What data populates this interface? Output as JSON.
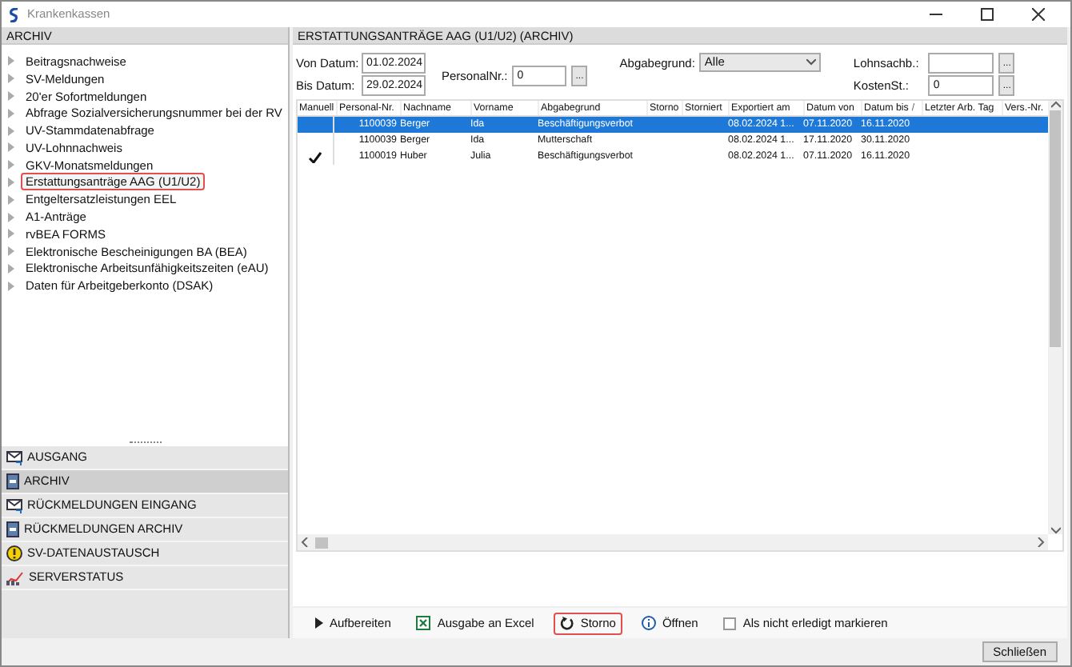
{
  "window": {
    "title": "Krankenkassen"
  },
  "sidebar": {
    "header": "ARCHIV",
    "tree": [
      {
        "label": "Beitragsnachweise",
        "selected": false
      },
      {
        "label": "SV-Meldungen",
        "selected": false
      },
      {
        "label": "20'er Sofortmeldungen",
        "selected": false
      },
      {
        "label": "Abfrage Sozialversicherungsnummer bei der RV",
        "selected": false
      },
      {
        "label": "UV-Stammdatenabfrage",
        "selected": false
      },
      {
        "label": "UV-Lohnnachweis",
        "selected": false
      },
      {
        "label": "GKV-Monatsmeldungen",
        "selected": false
      },
      {
        "label": "Erstattungsanträge AAG (U1/U2)",
        "selected": true
      },
      {
        "label": "Entgeltersatzleistungen EEL",
        "selected": false
      },
      {
        "label": "A1-Anträge",
        "selected": false
      },
      {
        "label": "rvBEA FORMS",
        "selected": false
      },
      {
        "label": "Elektronische Bescheinigungen BA (BEA)",
        "selected": false
      },
      {
        "label": "Elektronische Arbeitsunfähigkeitszeiten (eAU)",
        "selected": false
      },
      {
        "label": "Daten für Arbeitgeberkonto (DSAK)",
        "selected": false
      }
    ],
    "nav": [
      {
        "label": "AUSGANG",
        "kind": "outbox",
        "selected": false
      },
      {
        "label": "ARCHIV",
        "kind": "archive",
        "selected": true
      },
      {
        "label": "RÜCKMELDUNGEN EINGANG",
        "kind": "outbox",
        "selected": false
      },
      {
        "label": "RÜCKMELDUNGEN ARCHIV",
        "kind": "archive",
        "selected": false
      },
      {
        "label": "SV-DATENAUSTAUSCH",
        "kind": "warning",
        "selected": false
      },
      {
        "label": "SERVERSTATUS",
        "kind": "chart",
        "selected": false
      }
    ]
  },
  "main": {
    "header": "ERSTATTUNGSANTRÄGE AAG (U1/U2) (ARCHIV)",
    "filters": {
      "von_datum": {
        "label": "Von Datum:",
        "value": "01.02.2024"
      },
      "bis_datum": {
        "label": "Bis Datum:",
        "value": "29.02.2024"
      },
      "personal_nr": {
        "label": "PersonalNr.:",
        "value": "0",
        "button": "..."
      },
      "abgabegrund": {
        "label": "Abgabegrund:",
        "value": "Alle"
      },
      "lohnsachb": {
        "label": "Lohnsachb.:",
        "button": "..."
      },
      "kostenst": {
        "label": "KostenSt.:",
        "value": "0",
        "button": "..."
      }
    },
    "table": {
      "columns": [
        "Manuell",
        "Personal-Nr.",
        "Nachname",
        "Vorname",
        "Abgabegrund",
        "Storno",
        "Storniert",
        "Exportiert am",
        "Datum von",
        "Datum bis",
        "Letzter Arb. Tag",
        "Vers.-Nr."
      ],
      "sort_mark": "/",
      "rows": [
        {
          "selected": true,
          "manuell": false,
          "personal_nr": "1100039",
          "nachname": "Berger",
          "vorname": "Ida",
          "abgabegrund": "Beschäftigungsverbot",
          "exportiert_am": "08.02.2024 1...",
          "datum_von": "07.11.2020",
          "datum_bis": "16.11.2020"
        },
        {
          "selected": false,
          "manuell": false,
          "personal_nr": "1100039",
          "nachname": "Berger",
          "vorname": "Ida",
          "abgabegrund": "Mutterschaft",
          "exportiert_am": "08.02.2024 1...",
          "datum_von": "17.11.2020",
          "datum_bis": "30.11.2020"
        },
        {
          "selected": false,
          "manuell": true,
          "personal_nr": "1100019",
          "nachname": "Huber",
          "vorname": "Julia",
          "abgabegrund": "Beschäftigungsverbot",
          "exportiert_am": "08.02.2024 1...",
          "datum_von": "07.11.2020",
          "datum_bis": "16.11.2020"
        }
      ]
    },
    "actions": [
      {
        "label": "Aufbereiten",
        "kind": "play",
        "highlighted": false
      },
      {
        "label": "Ausgabe an Excel",
        "kind": "excel",
        "highlighted": false
      },
      {
        "label": "Storno",
        "kind": "undo",
        "highlighted": true
      },
      {
        "label": "Öffnen",
        "kind": "info",
        "highlighted": false
      },
      {
        "label": "Als nicht erledigt markieren",
        "kind": "checkbox",
        "checked": false,
        "highlighted": false
      }
    ]
  },
  "footer": {
    "close_button": "Schließen"
  }
}
